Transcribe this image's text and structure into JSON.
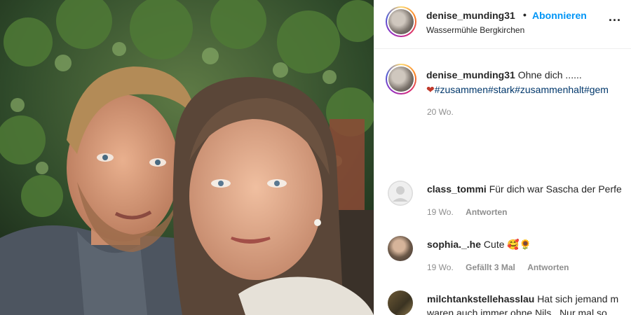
{
  "post": {
    "header": {
      "username": "denise_munding31",
      "separator": "•",
      "follow_label": "Abonnieren",
      "location": "Wassermühle Bergkirchen",
      "more_label": "..."
    },
    "caption": {
      "username": "denise_munding31",
      "text": "Ohne dich ......",
      "heart": "❤",
      "hashtags": "#zusammen#stark#zusammenhalt#gem",
      "age": "20 Wo."
    },
    "comments": [
      {
        "username": "class_tommi",
        "text": "Für dich war Sascha der Perfe",
        "age": "19 Wo.",
        "likes": "",
        "reply_label": "Antworten"
      },
      {
        "username": "sophia._.he",
        "text": "Cute 🥰🌻",
        "age": "19 Wo.",
        "likes": "Gefällt 3 Mal",
        "reply_label": "Antworten"
      },
      {
        "username": "milchtankstellehasslau",
        "text": "Hat sich jemand m",
        "text_line2": "waren auch immer ohne Nils . Nur mal so"
      }
    ]
  }
}
